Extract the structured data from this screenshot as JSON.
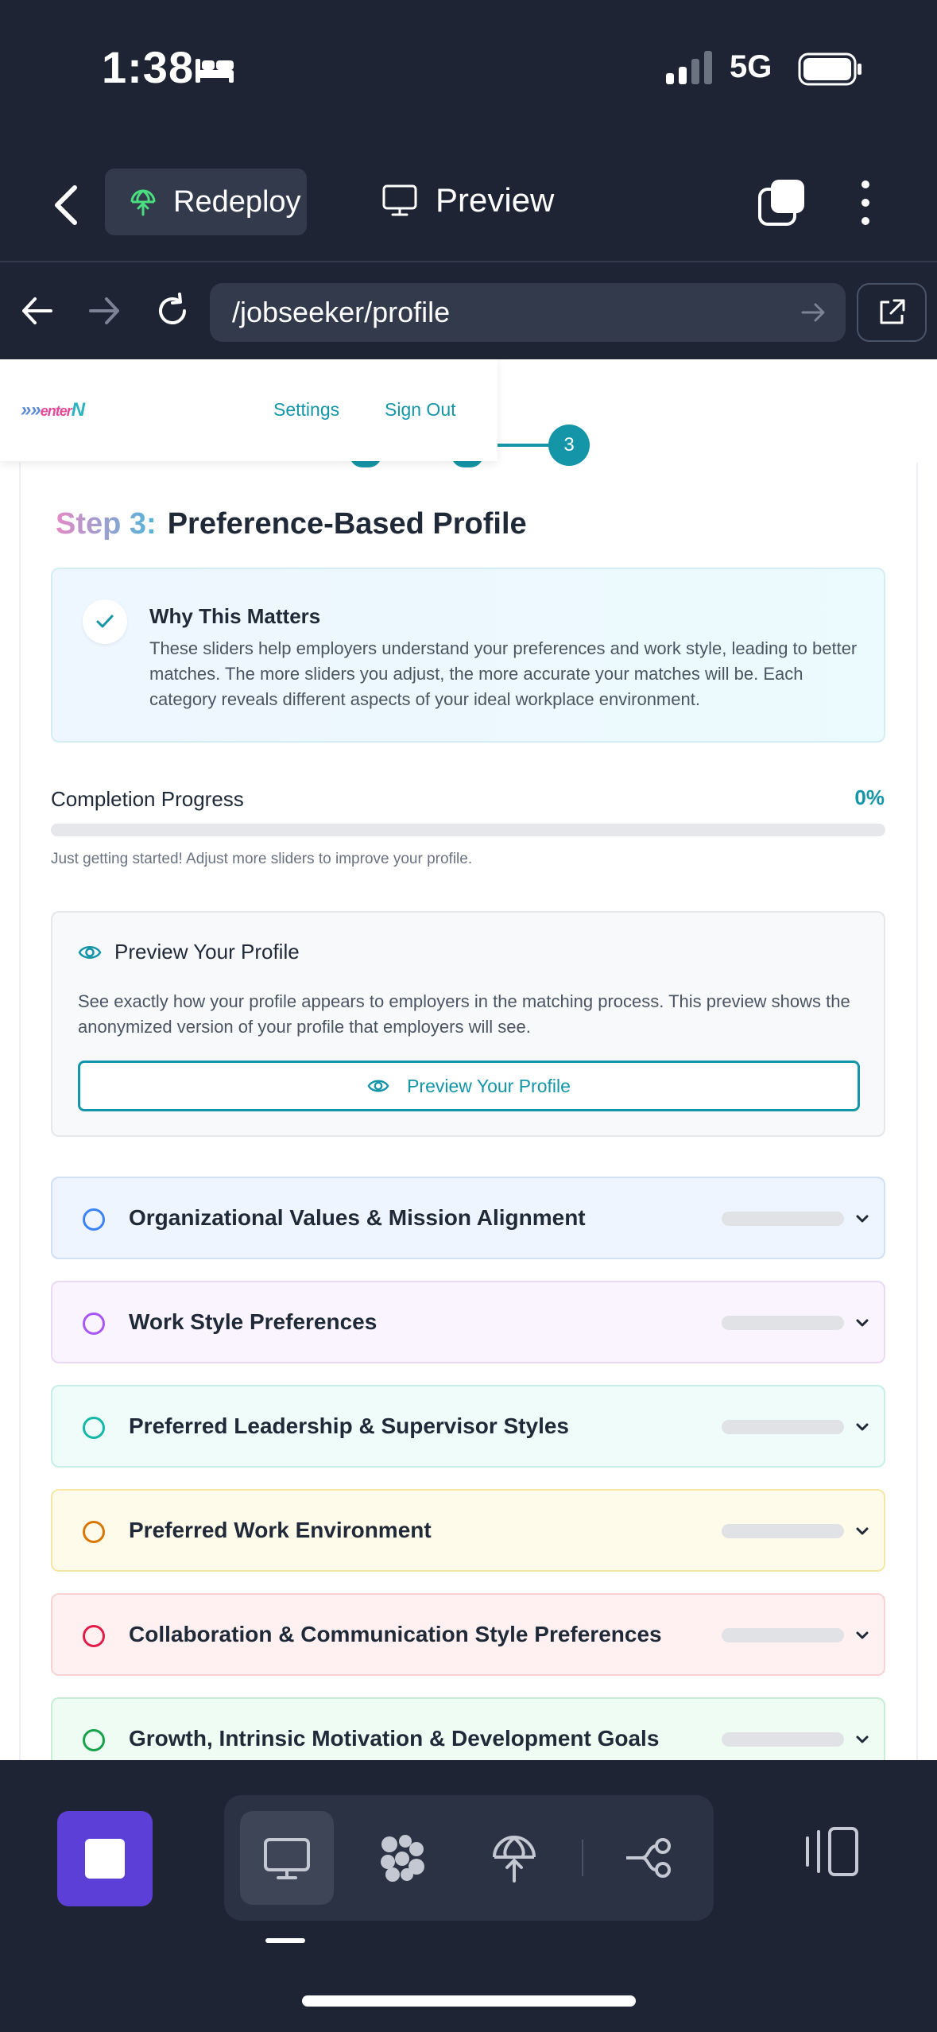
{
  "status_bar": {
    "time": "1:38",
    "network": "5G"
  },
  "toolbar": {
    "redeploy_label": "Redeploy",
    "preview_label": "Preview"
  },
  "browser": {
    "url": "/jobseeker/profile"
  },
  "site": {
    "logo": {
      "part1": "»»",
      "part2": "enter",
      "part3": "N"
    },
    "settings_label": "Settings",
    "signout_label": "Sign Out",
    "current_step": "3"
  },
  "page": {
    "step_label": "Step 3:",
    "step_title": "Preference-Based Profile",
    "why": {
      "title": "Why This Matters",
      "text": "These sliders help employers understand your preferences and work style, leading to better matches. The more sliders you adjust, the more accurate your matches will be. Each category reveals different aspects of your ideal workplace environment."
    },
    "progress": {
      "label": "Completion Progress",
      "percent_text": "0%",
      "value": 0,
      "hint": "Just getting started! Adjust more sliders to improve your profile."
    },
    "preview_box": {
      "title": "Preview Your Profile",
      "text": "See exactly how your profile appears to employers in the matching process. This preview shows the anonymized version of your profile that employers will see.",
      "button_label": "Preview Your Profile"
    },
    "sections": [
      {
        "title": "Organizational Values & Mission Alignment",
        "bg": "#eef5ff",
        "border": "#cfe0f7",
        "accent": "#3b82f6"
      },
      {
        "title": "Work Style Preferences",
        "bg": "#faf4ff",
        "border": "#ead8f7",
        "accent": "#a855f7"
      },
      {
        "title": "Preferred Leadership & Supervisor Styles",
        "bg": "#effcfa",
        "border": "#c7efe8",
        "accent": "#14b8a6"
      },
      {
        "title": "Preferred Work Environment",
        "bg": "#fffbea",
        "border": "#f6e6a6",
        "accent": "#d97706"
      },
      {
        "title": "Collaboration & Communication Style Preferences",
        "bg": "#fff1f1",
        "border": "#f8d2d2",
        "accent": "#e11d48"
      },
      {
        "title": "Growth, Intrinsic Motivation & Development Goals",
        "bg": "#eefcf3",
        "border": "#c6efd5",
        "accent": "#16a34a"
      }
    ]
  },
  "icons": {
    "bed": "bed-icon",
    "redeploy": "globe-upload-icon",
    "preview": "monitor-icon",
    "check": "check-icon",
    "eye": "eye-icon"
  }
}
